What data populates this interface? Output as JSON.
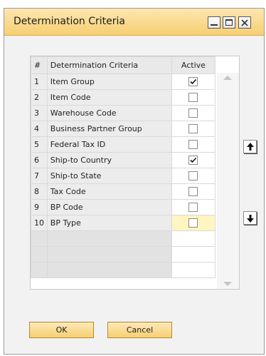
{
  "window": {
    "title": "Determination Criteria"
  },
  "grid": {
    "headers": {
      "num": "#",
      "criteria": "Determination Criteria",
      "active": "Active"
    },
    "rows": [
      {
        "num": "1",
        "criteria": "Item Group",
        "active": true
      },
      {
        "num": "2",
        "criteria": "Item Code",
        "active": false
      },
      {
        "num": "3",
        "criteria": "Warehouse Code",
        "active": false
      },
      {
        "num": "4",
        "criteria": "Business Partner Group",
        "active": false
      },
      {
        "num": "5",
        "criteria": "Federal Tax ID",
        "active": false
      },
      {
        "num": "6",
        "criteria": "Ship-to Country",
        "active": true
      },
      {
        "num": "7",
        "criteria": "Ship-to State",
        "active": false
      },
      {
        "num": "8",
        "criteria": "Tax Code",
        "active": false
      },
      {
        "num": "9",
        "criteria": "BP Code",
        "active": false
      },
      {
        "num": "10",
        "criteria": "BP Type",
        "active": false
      }
    ],
    "empty_rows": 3
  },
  "buttons": {
    "ok": "OK",
    "cancel": "Cancel"
  },
  "colors": {
    "accent": "#f7cf72",
    "focus_row": "#fff5c0"
  },
  "icons": {
    "move_up": "arrow-up-icon",
    "move_down": "arrow-down-icon",
    "minimize": "minimize-icon",
    "maximize": "maximize-icon",
    "close": "close-icon"
  }
}
